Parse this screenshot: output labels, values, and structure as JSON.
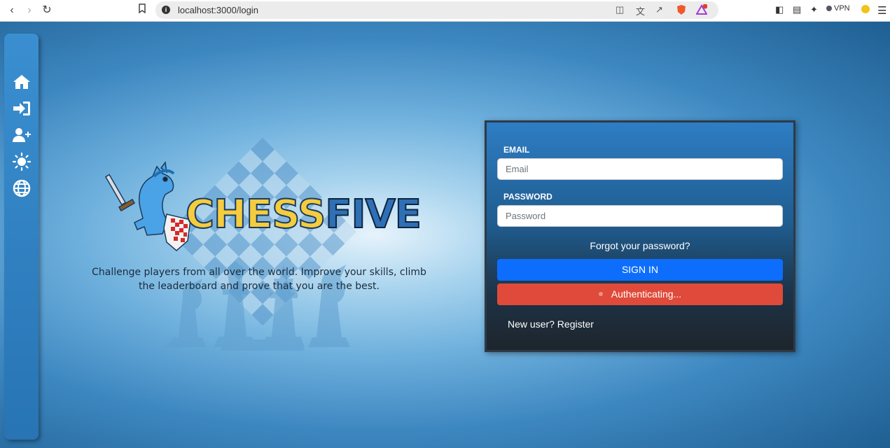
{
  "browser": {
    "url": "localhost:3000/login",
    "vpn_label": "VPN",
    "notification_count": "1"
  },
  "sidebar": {
    "items": [
      {
        "icon": "home-icon"
      },
      {
        "icon": "sign-in-icon"
      },
      {
        "icon": "user-plus-icon"
      },
      {
        "icon": "sun-icon"
      },
      {
        "icon": "globe-icon"
      }
    ]
  },
  "brand": {
    "name_part1": "CHESS",
    "name_part2": "FIVE",
    "tagline": "Challenge players from all over the world. Improve your skills, climb the leaderboard and prove that you are the best."
  },
  "login": {
    "email_label": "EMAIL",
    "email_placeholder": "Email",
    "password_label": "PASSWORD",
    "password_placeholder": "Password",
    "forgot_link": "Forgot your password?",
    "sign_in_button": "SIGN IN",
    "status_button": "Authenticating...",
    "register_link": "New user? Register"
  },
  "colors": {
    "primary": "#0d6efd",
    "danger": "#e04a3a",
    "sidebar": "#2f82c4",
    "brand_yellow": "#f4cc3e",
    "brand_blue": "#2f6fb5"
  }
}
